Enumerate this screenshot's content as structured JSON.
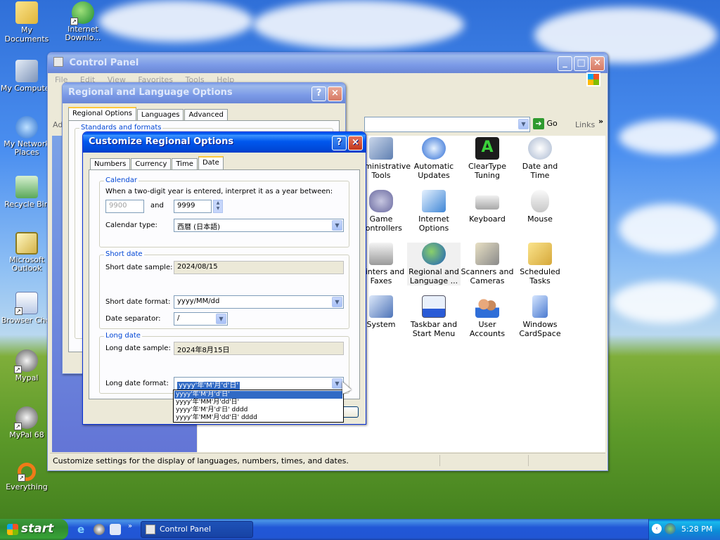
{
  "desktop": {
    "icons": [
      {
        "label": "My Documents"
      },
      {
        "label": "Internet Downlo..."
      },
      {
        "label": "My Computer"
      },
      {
        "label": "My Network Places"
      },
      {
        "label": "Recycle Bin"
      },
      {
        "label": "Microsoft Outlook"
      },
      {
        "label": "Browser Choi"
      },
      {
        "label": "Mypal"
      },
      {
        "label": "MyPal 68"
      },
      {
        "label": "Everything"
      }
    ]
  },
  "control_panel": {
    "title": "Control Panel",
    "menu": [
      "File",
      "Edit",
      "View",
      "Favorites",
      "Tools",
      "Help"
    ],
    "address_label": "Ad",
    "go_label": "Go",
    "links_label": "Links",
    "items": [
      {
        "label": "Administrative Tools"
      },
      {
        "label": "Automatic Updates"
      },
      {
        "label": "ClearType Tuning"
      },
      {
        "label": "Date and Time"
      },
      {
        "label": "Game Controllers"
      },
      {
        "label": "Internet Options"
      },
      {
        "label": "Keyboard"
      },
      {
        "label": "Mouse"
      },
      {
        "label": "Printers and Faxes"
      },
      {
        "label": "Regional and Language ..."
      },
      {
        "label": "Scanners and Cameras"
      },
      {
        "label": "Scheduled Tasks"
      },
      {
        "label": "System"
      },
      {
        "label": "Taskbar and Start Menu"
      },
      {
        "label": "User Accounts"
      },
      {
        "label": "Windows CardSpace"
      }
    ],
    "status": "Customize settings for the display of languages, numbers, times, and dates."
  },
  "regional_dialog": {
    "title": "Regional and Language Options",
    "tabs": [
      "Regional Options",
      "Languages",
      "Advanced"
    ],
    "group_label": "Standards and formats"
  },
  "customize_dialog": {
    "title": "Customize Regional Options",
    "tabs": [
      "Numbers",
      "Currency",
      "Time",
      "Date"
    ],
    "calendar": {
      "legend": "Calendar",
      "two_digit_text": "When a two-digit year is entered, interpret it as a year between:",
      "year_from": "9900",
      "and_label": "and",
      "year_to": "9999",
      "type_label": "Calendar type:",
      "type_value": "西暦 (日本語)"
    },
    "short_date": {
      "legend": "Short date",
      "sample_label": "Short date sample:",
      "sample_value": "2024/08/15",
      "format_label": "Short date format:",
      "format_value": "yyyy/MM/dd",
      "separator_label": "Date separator:",
      "separator_value": "/"
    },
    "long_date": {
      "legend": "Long date",
      "sample_label": "Long date sample:",
      "sample_value": "2024年8月15日",
      "format_label": "Long date format:",
      "format_value": "yyyy'年'M'月'd'日'",
      "options": [
        "yyyy'年'M'月'd'日'",
        "yyyy'年'MM'月'dd'日'",
        "yyyy'年'M'月'd'日' dddd",
        "yyyy'年'MM'月'dd'日' dddd"
      ]
    }
  },
  "taskbar": {
    "start_label": "start",
    "task_label": "Control Panel",
    "clock": "5:28 PM"
  }
}
